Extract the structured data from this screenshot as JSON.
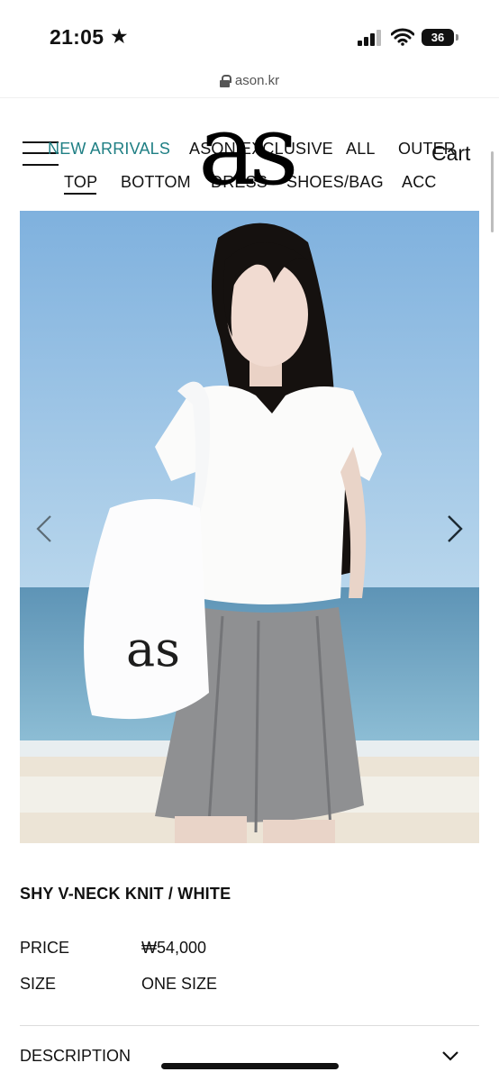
{
  "status_bar": {
    "time": "21:05",
    "star": "★",
    "battery": "36"
  },
  "browser": {
    "url": "ason.kr",
    "lock_icon": "lock-icon"
  },
  "header": {
    "logo": "as",
    "cart": "Cart",
    "menu_icon": "hamburger-menu-icon"
  },
  "nav": {
    "row1": [
      "NEW ARRIVALS",
      "ASON EXCLUSIVE",
      "ALL",
      "OUTER"
    ],
    "row2": [
      "TOP",
      "BOTTOM",
      "DRESS",
      "SHOES/BAG",
      "ACC"
    ],
    "active_color": "#1f7f84"
  },
  "gallery": {
    "prev_icon": "chevron-left-icon",
    "next_icon": "chevron-right-icon"
  },
  "product": {
    "title": "SHY V-NECK KNIT / WHITE",
    "price_label": "PRICE",
    "price_value": "₩54,000",
    "size_label": "SIZE",
    "size_value": "ONE SIZE",
    "description_label": "DESCRIPTION",
    "description_icon": "chevron-down-icon"
  }
}
